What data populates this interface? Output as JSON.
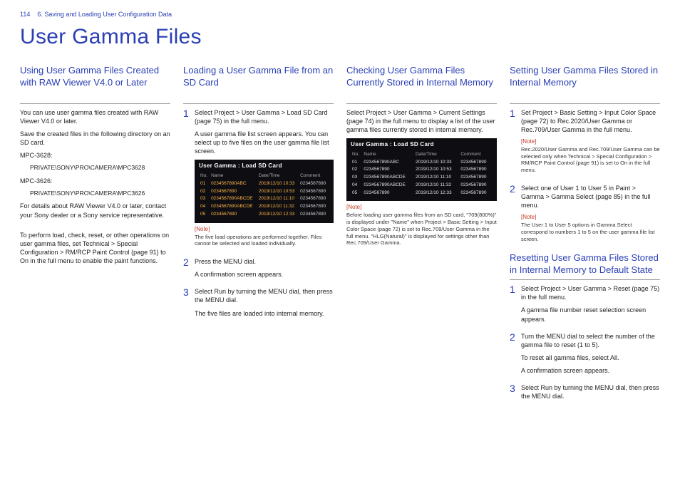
{
  "header": {
    "page_number": "114",
    "chapter": "6. Saving and Loading User Configuration Data"
  },
  "title": "User Gamma Files",
  "col1": {
    "heading": "Using User Gamma Files Created with RAW Viewer V4.0 or Later",
    "p1": "You can use user gamma files created with RAW Viewer V4.0 or later.",
    "p2": "Save the created files in the following directory on an SD card.",
    "model1_label": "MPC-3628:",
    "model1_path": "PRIVATE\\SONY\\PRO\\CAMERA\\MPC3628",
    "model2_label": "MPC-3626:",
    "model2_path": "PRIVATE\\SONY\\PRO\\CAMERA\\MPC3626",
    "p3": "For details about RAW Viewer V4.0 or later, contact your Sony dealer or a Sony service representative.",
    "p4": "To perform load, check, reset, or other operations on user gamma files, set Technical > Special Configuration > RM/RCP Paint Control (page 91) to On in the full menu to enable the paint functions."
  },
  "col2": {
    "heading": "Loading a User Gamma File from an SD Card",
    "step1": "Select Project > User Gamma > Load SD Card (page 75) in the full menu.",
    "step1b": "A user gamma file list screen appears. You can select up to five files on the user gamma file list screen.",
    "shot_title": "User Gamma : Load SD Card",
    "note_label": "[Note]",
    "note": "The five load operations are performed together. Files cannot be selected and loaded individually.",
    "step2": "Press the MENU dial.",
    "step2b": "A confirmation screen appears.",
    "step3": "Select Run by turning the MENU dial, then press the MENU dial.",
    "step3b": "The five files are loaded into internal memory."
  },
  "col3": {
    "heading": "Checking User Gamma Files Currently Stored in Internal Memory",
    "p1": "Select Project > User Gamma > Current Settings (page 74) in the full menu to display a list of the user gamma files currently stored in internal memory.",
    "shot_title": "User Gamma : Load SD Card",
    "note_label": "[Note]",
    "note": "Before loading user gamma files from an SD card, \"709(800%)\" is displayed under \"Name\" when Project > Basic Setting > Input Color Space (page 72) is set to Rec.709/User Gamma in the full menu. \"HLG(Natural)\" is displayed for settings other than Rec.709/User Gamma."
  },
  "col4": {
    "heading_a": "Setting User Gamma Files Stored in Internal Memory",
    "a_step1": "Set Project > Basic Setting > Input Color Space (page 72) to Rec.2020/User Gamma or Rec.709/User Gamma in the full menu.",
    "a_note_label": "[Note]",
    "a_note": "Rec.2020/User Gamma and Rec.709/User Gamma can be selected only when Technical > Special Configuration > RM/RCP Paint Control (page 91) is set to On in the full menu.",
    "a_step2": "Select one of User 1 to User 5 in Paint > Gamma > Gamma Select (page 85) in the full menu.",
    "a_note2_label": "[Note]",
    "a_note2": "The User 1 to User 5 options in Gamma Select correspond to numbers 1 to 5 on the user gamma file list screen.",
    "heading_b": "Resetting User Gamma Files Stored in Internal Memory to Default State",
    "b_step1": "Select Project > User Gamma > Reset (page 75) in the full menu.",
    "b_step1b": "A gamma file number reset selection screen appears.",
    "b_step2": "Turn the MENU dial to select the number of the gamma file to reset (1 to 5).",
    "b_step2b": "To reset all gamma files, select All.",
    "b_step2c": "A confirmation screen appears.",
    "b_step3": "Select Run by turning the MENU dial, then press the MENU dial."
  },
  "shot_table": {
    "headers": [
      "No.",
      "Name",
      "Date/Time",
      "Comment"
    ],
    "rows": [
      [
        "01",
        "0234567890ABC",
        "2019/12/10 10:33",
        "0234567890"
      ],
      [
        "02",
        "0234567890",
        "2019/12/10 10:53",
        "0234567890"
      ],
      [
        "03",
        "0234567890ABCDE",
        "2019/12/10 11:10",
        "0234567890"
      ],
      [
        "04",
        "0234567890ABCDE",
        "2019/12/10 11:32",
        "0234567890"
      ],
      [
        "05",
        "0234567890",
        "2019/12/10 12:33",
        "0234567890"
      ]
    ]
  },
  "nums": {
    "n1": "1",
    "n2": "2",
    "n3": "3"
  }
}
